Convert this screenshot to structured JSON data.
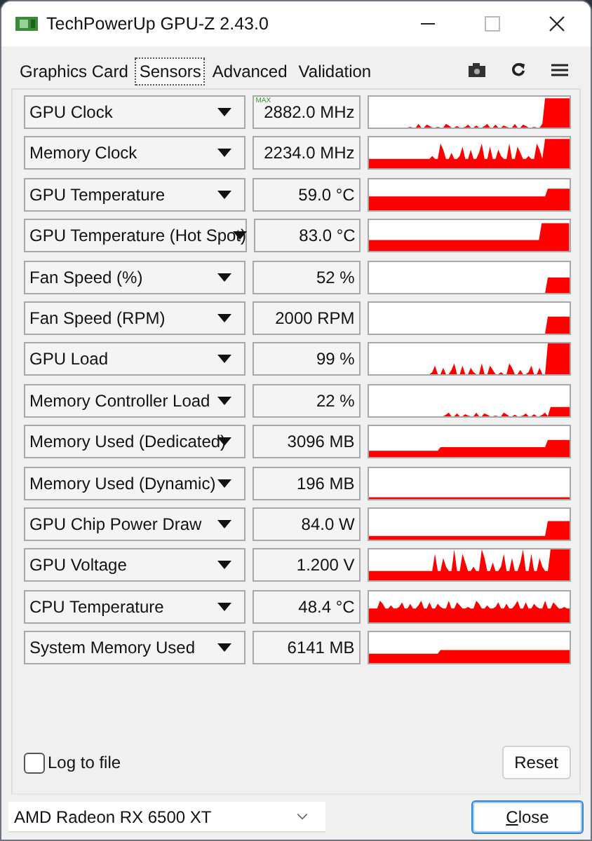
{
  "window": {
    "title": "TechPowerUp GPU-Z 2.43.0"
  },
  "tabs": [
    {
      "label": "Graphics Card",
      "selected": false
    },
    {
      "label": "Sensors",
      "selected": true
    },
    {
      "label": "Advanced",
      "selected": false
    },
    {
      "label": "Validation",
      "selected": false
    }
  ],
  "sensors": [
    {
      "name": "GPU Clock",
      "value": "2882.0 MHz",
      "badge": "MAX"
    },
    {
      "name": "Memory Clock",
      "value": "2234.0 MHz"
    },
    {
      "name": "GPU Temperature",
      "value": "59.0 °C"
    },
    {
      "name": "GPU Temperature (Hot Spot)",
      "value": "83.0 °C"
    },
    {
      "name": "Fan Speed (%)",
      "value": "52 %"
    },
    {
      "name": "Fan Speed (RPM)",
      "value": "2000 RPM"
    },
    {
      "name": "GPU Load",
      "value": "99 %"
    },
    {
      "name": "Memory Controller Load",
      "value": "22 %"
    },
    {
      "name": "Memory Used (Dedicated)",
      "value": "3096 MB"
    },
    {
      "name": "Memory Used (Dynamic)",
      "value": "196 MB"
    },
    {
      "name": "GPU Chip Power Draw",
      "value": "84.0 W"
    },
    {
      "name": "GPU Voltage",
      "value": "1.200 V"
    },
    {
      "name": "CPU Temperature",
      "value": "48.4 °C"
    },
    {
      "name": "System Memory Used",
      "value": "6141 MB"
    }
  ],
  "log_to_file": {
    "label": "Log to file",
    "checked": false
  },
  "reset_button": "Reset",
  "device": "AMD Radeon RX 6500 XT",
  "close_button": "Close"
}
